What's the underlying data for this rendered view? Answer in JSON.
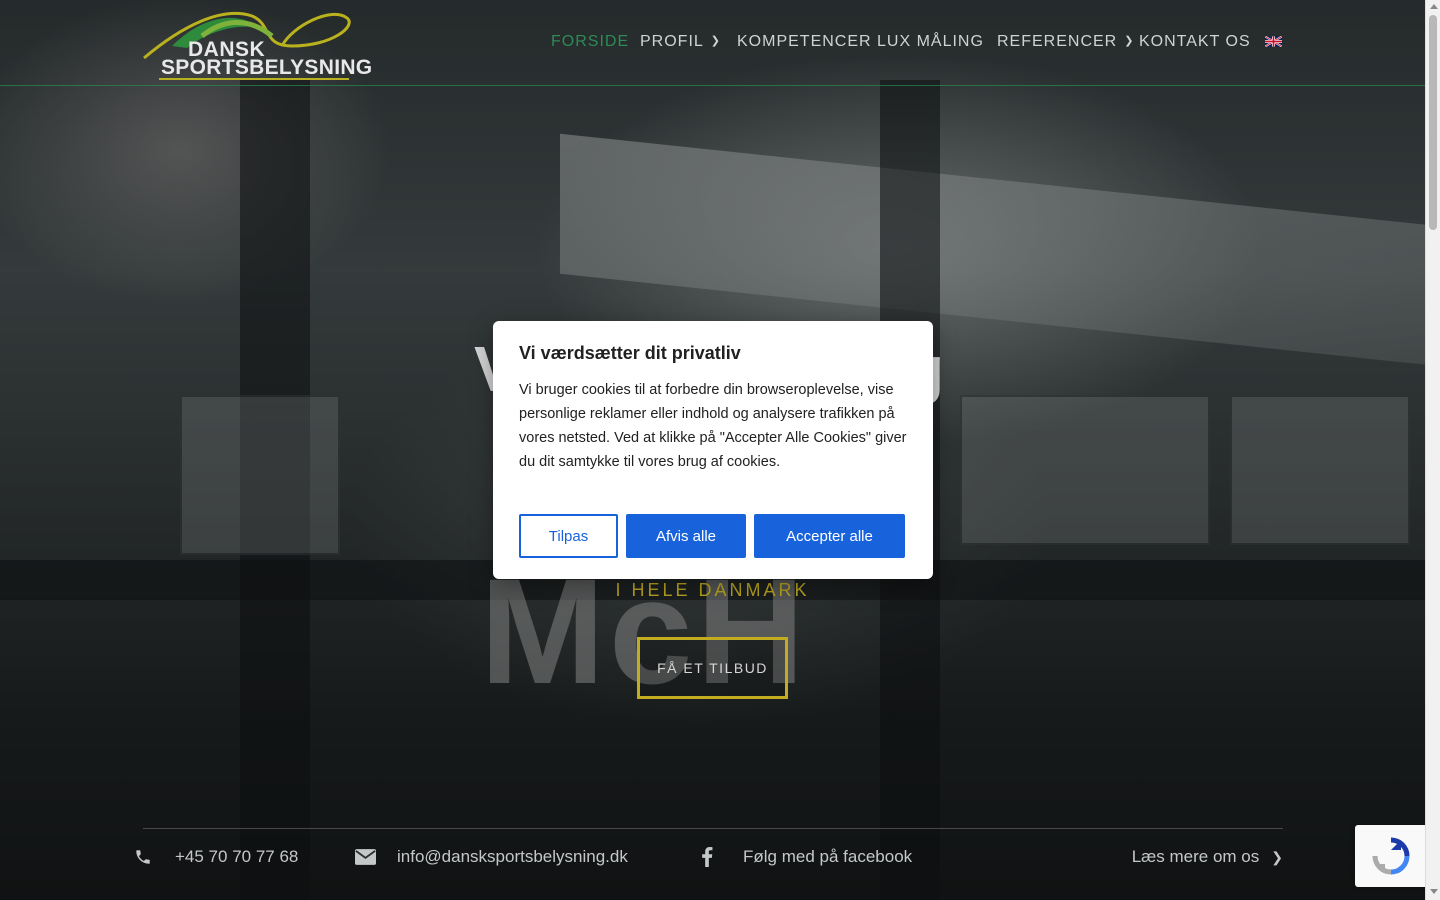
{
  "header": {
    "logo": {
      "line1": "DANSK",
      "line2": "SPORTSBELYSNING"
    },
    "nav": [
      {
        "label": "FORSIDE",
        "active": true,
        "has_dropdown": false
      },
      {
        "label": "PROFIL",
        "active": false,
        "has_dropdown": true
      },
      {
        "label": "KOMPETENCER",
        "active": false,
        "has_dropdown": false
      },
      {
        "label": "LUX MÅLING",
        "active": false,
        "has_dropdown": false
      },
      {
        "label": "REFERENCER",
        "active": false,
        "has_dropdown": true
      },
      {
        "label": "KONTAKT OS",
        "active": false,
        "has_dropdown": false
      }
    ],
    "language_flag_icon": "uk-flag-icon"
  },
  "hero": {
    "title_fragment_left": "V",
    "title_fragment_right": "g",
    "subtitle": "I HELE DANMARK",
    "cta_label": "FÅ ET TILBUD",
    "background_text": "McH"
  },
  "contact_bar": {
    "phone": "+45 70 70 77 68",
    "email": "info@dansksportsbelysning.dk",
    "facebook": "Følg med på facebook",
    "more": "Læs mere om os"
  },
  "cookie_modal": {
    "title": "Vi værdsætter dit privatliv",
    "text": "Vi bruger cookies til at forbedre din browseroplevelse, vise personlige reklamer eller indhold og analysere trafikken på vores netsted. Ved at klikke på \"Accepter Alle Cookies\" giver du dit samtykke til vores brug af cookies.",
    "buttons": {
      "customize": "Tilpas",
      "reject": "Afvis alle",
      "accept": "Accepter alle"
    }
  },
  "colors": {
    "nav_active": "#2e8b57",
    "accent_gold": "#c2ad21",
    "button_blue": "#1863dc"
  }
}
